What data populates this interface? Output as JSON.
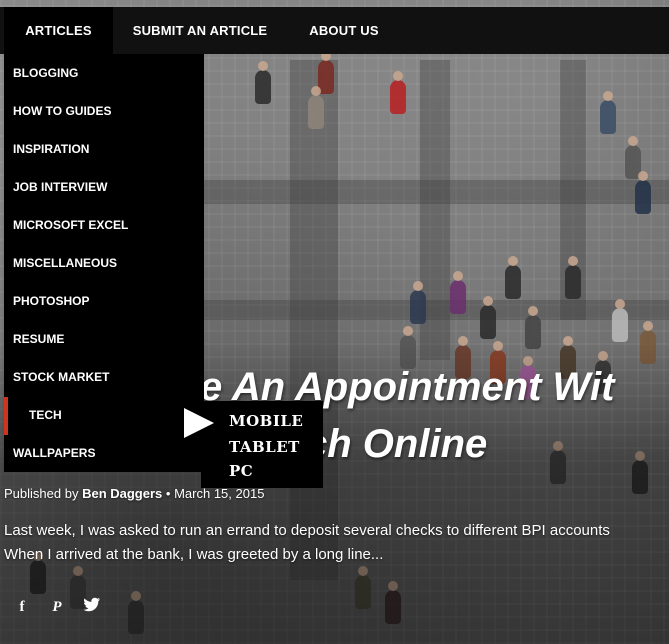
{
  "nav": {
    "items": [
      {
        "label": "ARTICLES"
      },
      {
        "label": "SUBMIT AN ARTICLE"
      },
      {
        "label": "ABOUT US"
      }
    ],
    "active_index": 0
  },
  "dropdown": {
    "items": [
      {
        "label": "BLOGGING"
      },
      {
        "label": "HOW TO GUIDES"
      },
      {
        "label": "INSPIRATION"
      },
      {
        "label": "JOB INTERVIEW"
      },
      {
        "label": "MICROSOFT EXCEL"
      },
      {
        "label": "MISCELLANEOUS"
      },
      {
        "label": "PHOTOSHOP"
      },
      {
        "label": "RESUME"
      },
      {
        "label": "STOCK MARKET"
      },
      {
        "label": "TECH"
      },
      {
        "label": "WALLPAPERS"
      }
    ],
    "hovered_label": "TECH",
    "accent_color": "#d0341e"
  },
  "flyout": {
    "items": [
      {
        "label": "MOBILE"
      },
      {
        "label": "TABLET"
      },
      {
        "label": "PC"
      }
    ]
  },
  "post": {
    "title_line1": "e An Appointment Wit",
    "title_line2": "ch Online",
    "meta_prefix": "Published by",
    "author": "Ben Daggers",
    "date": "March 15, 2015",
    "excerpt_line1": "Last week, I was asked to run an errand to deposit several checks to different BPI accounts",
    "excerpt_line2": "When I arrived at the bank, I was greeted by a long line..."
  },
  "share": {
    "facebook_glyph": "f",
    "pinterest_glyph": "P",
    "twitter_glyph": "t"
  },
  "icons": [
    "facebook-icon",
    "pinterest-icon",
    "twitter-icon",
    "flyout-arrow-icon"
  ]
}
